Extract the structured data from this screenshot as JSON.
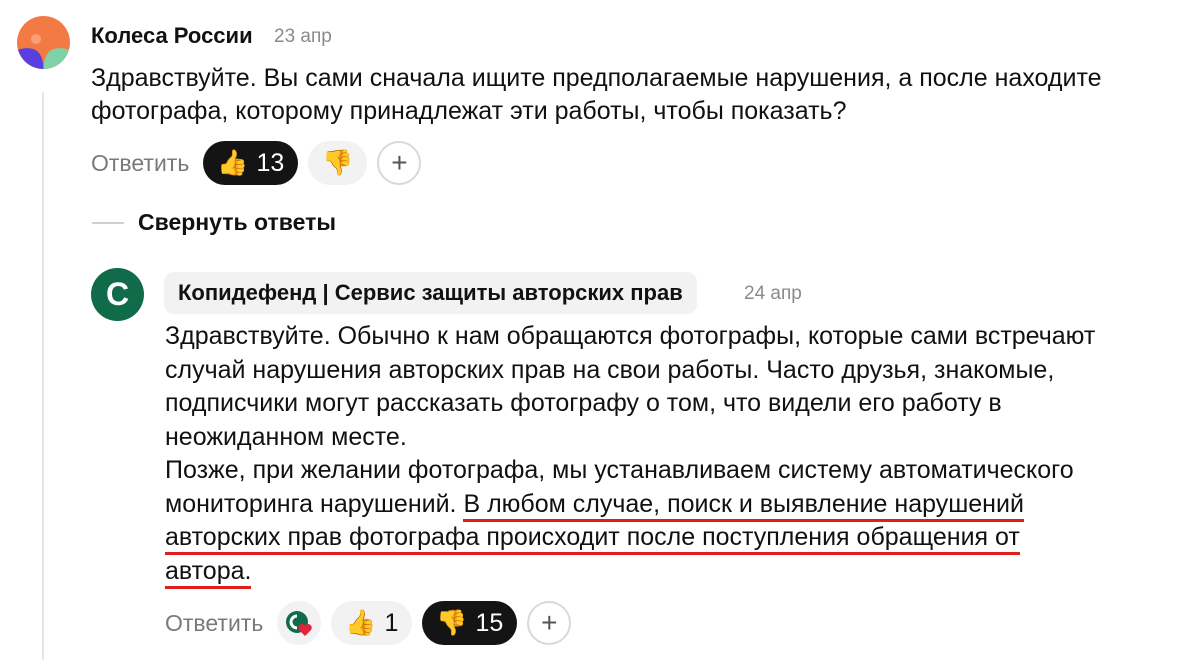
{
  "comments": [
    {
      "author": "Колеса России",
      "date": "23 апр",
      "text_lines": [
        "Здравствуйте. Вы сами сначала ищите предполагаемые нарушения, а после находите",
        "фотографа, которому принадлежат эти работы, чтобы показать?"
      ],
      "reply_label": "Ответить",
      "like_count": "13",
      "like_emoji": "👍",
      "dislike_emoji": "👎",
      "add_reaction": "+"
    },
    {
      "author": "Копидефенд | Сервис защиты авторских прав",
      "date": "24 апр",
      "avatar_letter": "C",
      "text_lines": [
        {
          "plain": "Здравствуйте. Обычно к нам обращаются фотографы, которые сами встречают",
          "underlined": ""
        },
        {
          "plain": "случай нарушения авторских прав на свои работы. Часто друзья, знакомые,",
          "underlined": ""
        },
        {
          "plain": "подписчики могут рассказать фотографу о том, что видели его работу в",
          "underlined": ""
        },
        {
          "plain": "неожиданном месте.",
          "underlined": ""
        },
        {
          "plain": "Позже, при желании фотографа, мы устанавливаем систему автоматического",
          "underlined": ""
        },
        {
          "plain": "мониторинга нарушений. ",
          "underlined": "В любом случае, поиск и выявление нарушений"
        },
        {
          "plain": "",
          "underlined": "авторских прав фотографа происходит после поступления обращения от"
        },
        {
          "plain": "",
          "underlined": "автора."
        }
      ],
      "reply_label": "Ответить",
      "like_count": "1",
      "dislike_count": "15",
      "like_emoji": "👍",
      "dislike_emoji": "👎",
      "add_reaction": "+"
    }
  ],
  "collapse_label": "Свернуть ответы",
  "colors": {
    "underline": "#e01e1e",
    "brand_green": "#0f6b4a",
    "avatar_orange": "#f47a45",
    "avatar_purple": "#5a3ee0",
    "avatar_green": "#7fd1a8",
    "emoji_yellow": "#f5b51f"
  }
}
